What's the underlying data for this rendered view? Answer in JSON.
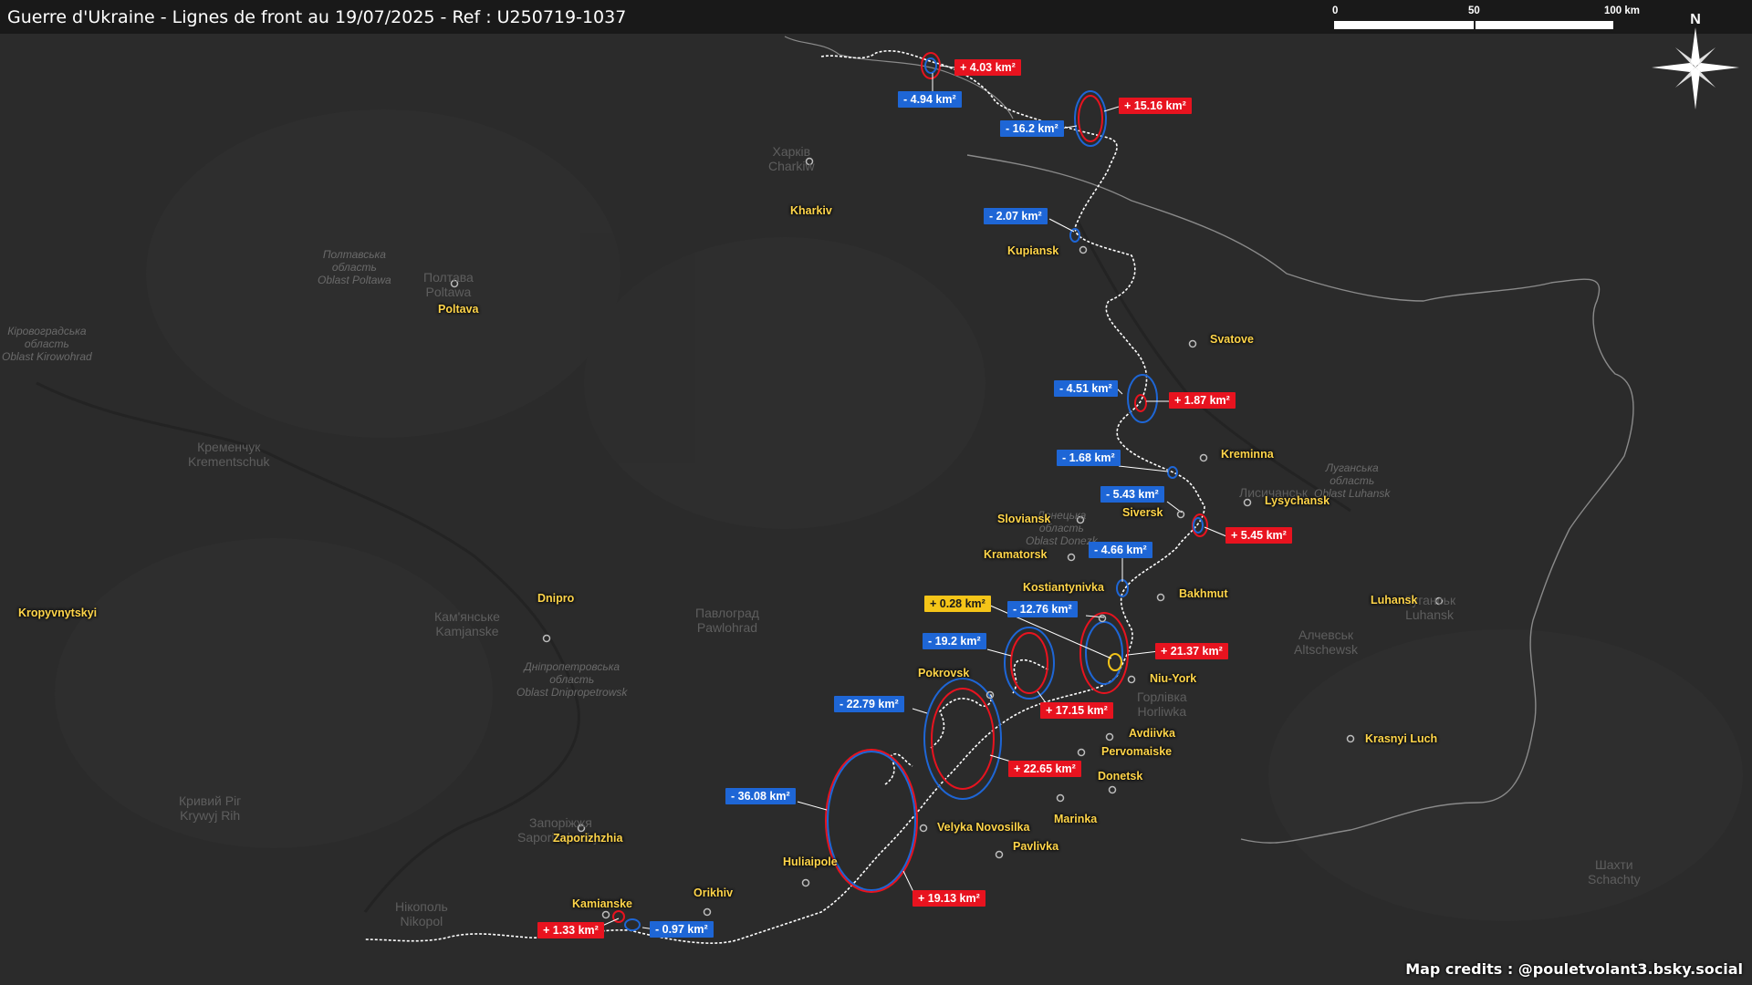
{
  "title": "Guerre d'Ukraine - Lignes de front au 19/07/2025 - Ref : U250719-1037",
  "credits": "Map credits : @pouletvolant3.bsky.social",
  "scale": {
    "labels": [
      "0",
      "50",
      "100 km"
    ]
  },
  "compass": {
    "label": "N",
    "icon": "compass-rose-icon"
  },
  "colors": {
    "gain": "#e8131f",
    "loss": "#1e66d6",
    "neutral": "#f5c518",
    "city_label": "#ffd54a",
    "front_line": "#ffffff",
    "background": "#2b2b2b"
  },
  "cities": [
    {
      "name": "Kharkiv"
    },
    {
      "name": "Kupiansk"
    },
    {
      "name": "Poltava"
    },
    {
      "name": "Svatove"
    },
    {
      "name": "Kreminna"
    },
    {
      "name": "Lysychansk"
    },
    {
      "name": "Siversk"
    },
    {
      "name": "Sloviansk"
    },
    {
      "name": "Kramatorsk"
    },
    {
      "name": "Kostiantynivka"
    },
    {
      "name": "Bakhmut"
    },
    {
      "name": "Luhansk"
    },
    {
      "name": "Dnipro"
    },
    {
      "name": "Kropyvnytskyi"
    },
    {
      "name": "Pokrovsk"
    },
    {
      "name": "Niu-York"
    },
    {
      "name": "Avdiivka"
    },
    {
      "name": "Pervomaiske"
    },
    {
      "name": "Donetsk"
    },
    {
      "name": "Marinka"
    },
    {
      "name": "Krasnyi Luch"
    },
    {
      "name": "Velyka Novosilka"
    },
    {
      "name": "Pavlivka"
    },
    {
      "name": "Huliaipole"
    },
    {
      "name": "Zaporizhzhia"
    },
    {
      "name": "Orikhiv"
    },
    {
      "name": "Kamianske"
    }
  ],
  "base_labels": [
    {
      "text": "Харків\nCharkiw"
    },
    {
      "text": "Полтавська\nобласть\nOblast Poltawa"
    },
    {
      "text": "Полтава\nPoltawa"
    },
    {
      "text": "Кременчук\nKrementschuk"
    },
    {
      "text": "Кам'янське\nKamjanske"
    },
    {
      "text": "Павлоград\nPawlohrad"
    },
    {
      "text": "Дніпропетровська\nобласть\nOblast Dnipropetrowsk"
    },
    {
      "text": "Кривий Ріг\nKrywyj Rih"
    },
    {
      "text": "Запоріжжя\nSaporischschja"
    },
    {
      "text": "Нікополь\nNikopol"
    },
    {
      "text": "Луганська\nобласть\nOblast Luhansk"
    },
    {
      "text": "Лисичанськ"
    },
    {
      "text": "Алчевськ\nAltschewsk"
    },
    {
      "text": "Луганськ\nLuhansk"
    },
    {
      "text": "Горлівка\nHorliwka"
    },
    {
      "text": "Шахти\nSchachty"
    },
    {
      "text": "Кіровоградська\nобласть\nOblast Kirowohrad"
    },
    {
      "text": "Донецька\nобласть\nOblast Donezk"
    }
  ],
  "changes": [
    {
      "label": "+ 4.03 km²",
      "type": "gain"
    },
    {
      "label": "- 4.94 km²",
      "type": "loss"
    },
    {
      "label": "+ 15.16 km²",
      "type": "gain"
    },
    {
      "label": "- 16.2 km²",
      "type": "loss"
    },
    {
      "label": "- 2.07 km²",
      "type": "loss"
    },
    {
      "label": "- 4.51 km²",
      "type": "loss"
    },
    {
      "label": "+ 1.87 km²",
      "type": "gain"
    },
    {
      "label": "- 1.68 km²",
      "type": "loss"
    },
    {
      "label": "- 5.43 km²",
      "type": "loss"
    },
    {
      "label": "+ 5.45 km²",
      "type": "gain"
    },
    {
      "label": "- 4.66 km²",
      "type": "loss"
    },
    {
      "label": "+ 0.28 km²",
      "type": "neutral"
    },
    {
      "label": "- 12.76 km²",
      "type": "loss"
    },
    {
      "label": "+ 21.37 km²",
      "type": "gain"
    },
    {
      "label": "- 19.2 km²",
      "type": "loss"
    },
    {
      "label": "+ 17.15 km²",
      "type": "gain"
    },
    {
      "label": "- 22.79 km²",
      "type": "loss"
    },
    {
      "label": "+ 22.65 km²",
      "type": "gain"
    },
    {
      "label": "- 36.08 km²",
      "type": "loss"
    },
    {
      "label": "+ 19.13 km²",
      "type": "gain"
    },
    {
      "label": "+ 1.33 km²",
      "type": "gain"
    },
    {
      "label": "- 0.97 km²",
      "type": "loss"
    }
  ]
}
